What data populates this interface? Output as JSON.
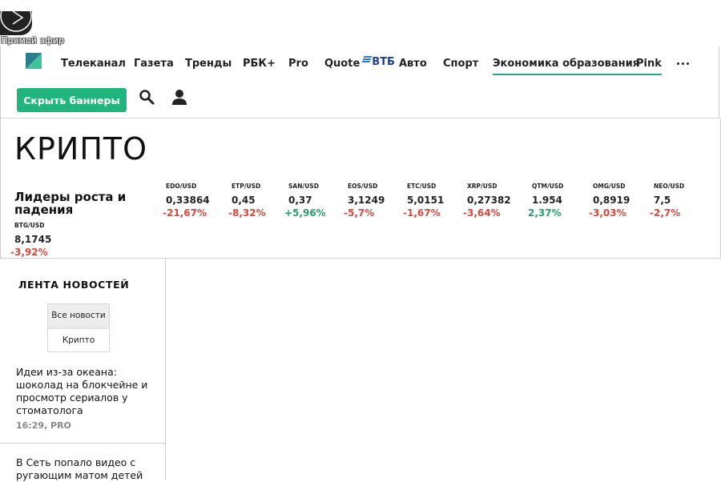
{
  "live": {
    "label": "Прямой эфир"
  },
  "nav": {
    "items": [
      {
        "label": "Телеканал"
      },
      {
        "label": "Газета"
      },
      {
        "label": "Тренды"
      },
      {
        "label": "РБК+"
      },
      {
        "label": "Pro"
      },
      {
        "label": "Quote"
      },
      {
        "label": "Авто"
      },
      {
        "label": "Спорт"
      },
      {
        "label": "Экономика образования"
      },
      {
        "label": "Pink"
      }
    ],
    "vtb_label": "ВТБ",
    "more_icon": "more-dots-icon"
  },
  "header": {
    "hide_banners_label": "Скрыть баннеры",
    "search_icon": "search-icon",
    "user_icon": "user-icon"
  },
  "page": {
    "title": "КРИПТО"
  },
  "leaders": {
    "title": "Лидеры роста и падения",
    "tickers": [
      {
        "pair": "EDO/USD",
        "price": "0,33864",
        "change": "-21,67%",
        "trend": "neg"
      },
      {
        "pair": "ETP/USD",
        "price": "0,45",
        "change": "-8,32%",
        "trend": "neg"
      },
      {
        "pair": "SAN/USD",
        "price": "0,37",
        "change": "+5,96%",
        "trend": "pos"
      },
      {
        "pair": "EOS/USD",
        "price": "3,1249",
        "change": "-5,7%",
        "trend": "neg"
      },
      {
        "pair": "ETC/USD",
        "price": "5,0151",
        "change": "-1,67%",
        "trend": "neg"
      },
      {
        "pair": "XRP/USD",
        "price": "0,27382",
        "change": "-3,64%",
        "trend": "neg"
      },
      {
        "pair": "QTM/USD",
        "price": "1.954",
        "change": "2,37%",
        "trend": "pos"
      },
      {
        "pair": "OMG/USD",
        "price": "0,8919",
        "change": "-3,03%",
        "trend": "neg"
      },
      {
        "pair": "NEO/USD",
        "price": "7,5",
        "change": "-2,7%",
        "trend": "neg"
      },
      {
        "pair": "BTG/USD",
        "price": "8,1745",
        "change": "-3,92%",
        "trend": "neg"
      }
    ],
    "colors": {
      "negative": "#d6493c",
      "positive": "#2d9c6a"
    }
  },
  "feed": {
    "title": "ЛЕНТА НОВОСТЕЙ",
    "filters": [
      {
        "label": "Все новости",
        "selected": true
      },
      {
        "label": "Крипто",
        "selected": false
      }
    ],
    "items": [
      {
        "title": "Идеи из-за океана: шоколад на блокчейне и просмотр сериалов у стоматолога",
        "meta": "16:29, PRO"
      },
      {
        "title": "В Сеть попало видео с ругающим матом детей",
        "meta": ""
      }
    ]
  },
  "colors": {
    "accent": "#1fb57c",
    "nav_underline": "#2aa87c"
  }
}
